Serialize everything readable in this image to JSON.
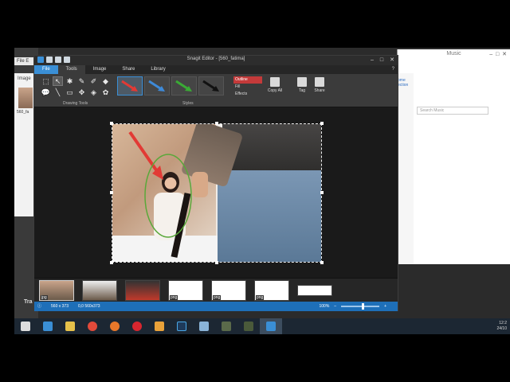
{
  "background_app": {
    "menu": "File  E",
    "library_tab": "Image",
    "thumb_label": "560_fa",
    "timeline_label": "Tra"
  },
  "music_window": {
    "title": "Music",
    "search_placeholder": "Search Music",
    "side_items": [
      "ome",
      "ection"
    ]
  },
  "snagit": {
    "title": "Snagit Editor - [560_fatima]",
    "tabs": [
      "File",
      "Tools",
      "Image",
      "Share",
      "Library"
    ],
    "active_tab": "Tools",
    "help": "?",
    "group_labels": {
      "drawing_tools": "Drawing Tools",
      "styles": "Styles"
    },
    "styles": [
      {
        "color": "#e23a35"
      },
      {
        "color": "#3e8ad8"
      },
      {
        "color": "#3aaa35"
      },
      {
        "color": "#111111"
      }
    ],
    "format_items": [
      "Outline",
      "Fill",
      "Effects"
    ],
    "buttons": [
      "Copy All",
      "Tag",
      "Share"
    ],
    "status": {
      "dimensions": "560 x 373",
      "cursor": "0,0  560x373",
      "zoom": "100%",
      "zoom_level": 0.55
    },
    "tray": [
      {
        "label": "jpg",
        "selected": true
      },
      {
        "label": "",
        "selected": false
      },
      {
        "label": "",
        "selected": false
      },
      {
        "label": "png",
        "selected": false
      },
      {
        "label": "png",
        "selected": false
      },
      {
        "label": "png",
        "selected": false
      },
      {
        "label": "",
        "selected": false
      }
    ]
  },
  "taskbar": {
    "apps": [
      "start",
      "ie",
      "explorer",
      "chrome",
      "firefox",
      "opera",
      "media",
      "photoshop",
      "app",
      "app2",
      "app3",
      "snagit"
    ],
    "active": "snagit",
    "time": "12:2",
    "date": "24/10"
  }
}
